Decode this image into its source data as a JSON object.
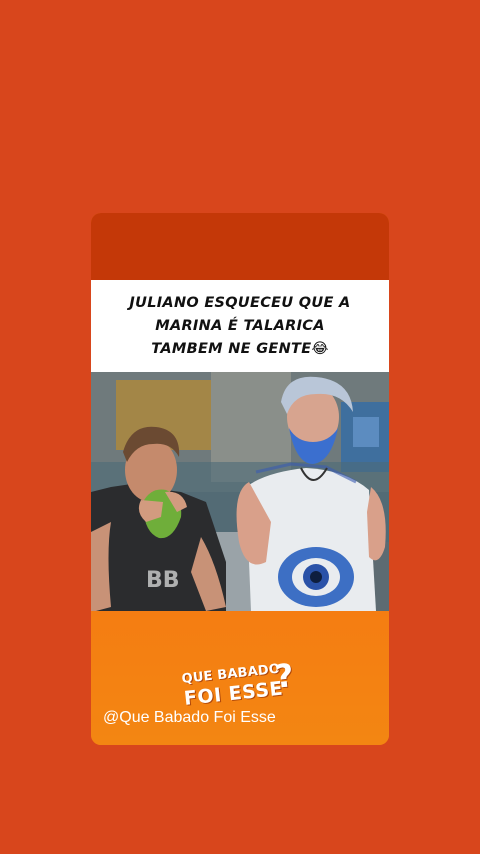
{
  "post": {
    "caption_lines": [
      "JULIANO ESQUECEU QUE A",
      "MARINA É TALARICA",
      "TAMBEM NE GENTE😂"
    ],
    "logo_line1": "QUE BABADO",
    "logo_line2": "FOI ESSE",
    "logo_mark": "?",
    "handle": "@Que Babado Foi Esse"
  },
  "colors": {
    "background": "#d8461c",
    "card_top": "#c43808",
    "card_bottom": "#f07d0f",
    "caption_bg": "#ffffff"
  }
}
